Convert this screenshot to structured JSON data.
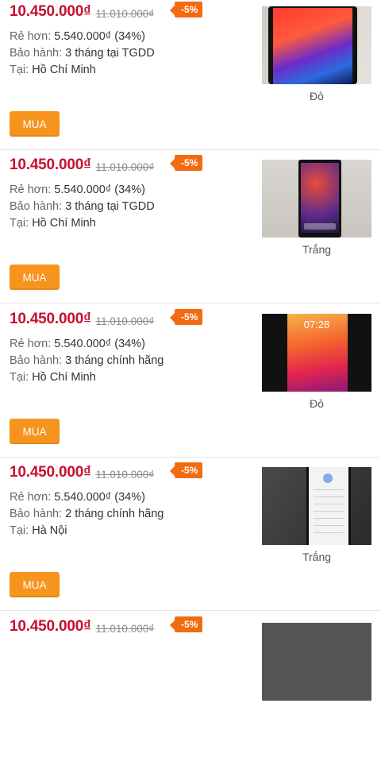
{
  "items": [
    {
      "price": "10.450.000₫",
      "old_price": "11.010.000₫",
      "discount": "-5%",
      "saving_label": "Rẻ hơn:",
      "saving_value": "5.540.000₫ (34%)",
      "warranty_label": "Bảo hành:",
      "warranty_value": "3 tháng tại TGDD",
      "location_label": "Tại:",
      "location_value": "Hồ Chí Minh",
      "buy_label": "MUA",
      "color": "Đỏ",
      "thumb": "phone-red"
    },
    {
      "price": "10.450.000₫",
      "old_price": "11.010.000₫",
      "discount": "-5%",
      "saving_label": "Rẻ hơn:",
      "saving_value": "5.540.000₫ (34%)",
      "warranty_label": "Bảo hành:",
      "warranty_value": "3 tháng tại TGDD",
      "location_label": "Tại:",
      "location_value": "Hồ Chí Minh",
      "buy_label": "MUA",
      "color": "Trắng",
      "thumb": "phone-white"
    },
    {
      "price": "10.450.000₫",
      "old_price": "11.010.000₫",
      "discount": "-5%",
      "saving_label": "Rẻ hơn:",
      "saving_value": "5.540.000₫ (34%)",
      "warranty_label": "Bảo hành:",
      "warranty_value": "3 tháng chính hãng",
      "location_label": "Tại:",
      "location_value": "Hồ Chí Minh",
      "buy_label": "MUA",
      "color": "Đỏ",
      "thumb": "phone-red-lock",
      "thumb_time": "07:28"
    },
    {
      "price": "10.450.000₫",
      "old_price": "11.010.000₫",
      "discount": "-5%",
      "saving_label": "Rẻ hơn:",
      "saving_value": "5.540.000₫ (34%)",
      "warranty_label": "Bảo hành:",
      "warranty_value": "2 tháng chính hãng",
      "location_label": "Tại:",
      "location_value": "Hà Nội",
      "buy_label": "MUA",
      "color": "Trắng",
      "thumb": "phone-settings"
    },
    {
      "price": "10.450.000₫",
      "old_price": "11.010.000₫",
      "discount": "-5%",
      "thumb": "phone-dark"
    }
  ],
  "colors": {
    "price": "#c8102e",
    "badge": "#f26b0f",
    "buy_button": "#f7941d"
  }
}
